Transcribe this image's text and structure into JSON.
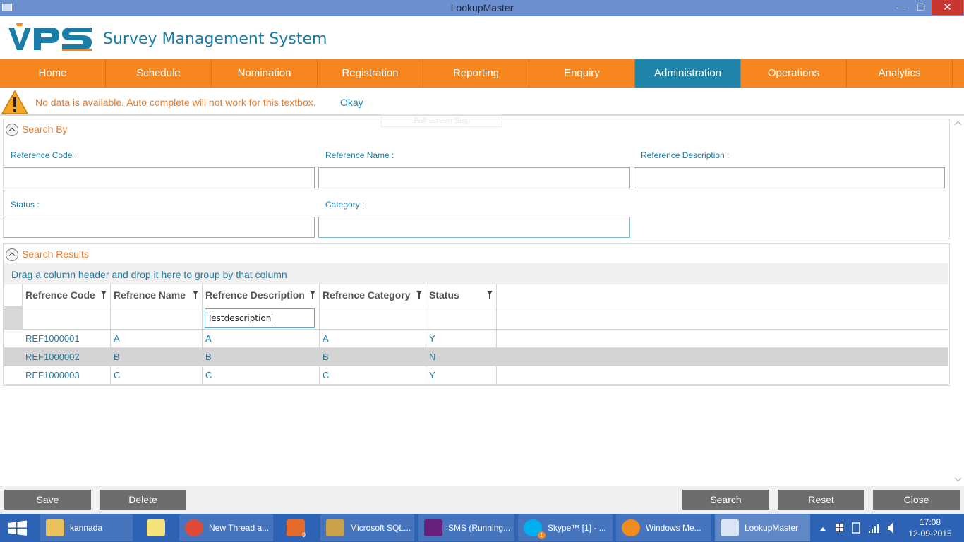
{
  "window": {
    "title": "LookupMaster",
    "minimize": "—",
    "maximize": "❐",
    "close": "✕"
  },
  "header": {
    "logo_text": "VPS",
    "brand": "Survey Management System"
  },
  "nav": {
    "items": [
      {
        "label": "Home"
      },
      {
        "label": "Schedule"
      },
      {
        "label": "Nomination"
      },
      {
        "label": "Registration"
      },
      {
        "label": "Reporting"
      },
      {
        "label": "Enquiry"
      },
      {
        "label": "Administration"
      },
      {
        "label": "Operations"
      },
      {
        "label": "Analytics"
      }
    ],
    "active": "Administration"
  },
  "warning": {
    "message": "No data is available. Auto complete will not work for this textbox.",
    "okay_label": "Okay"
  },
  "search_by": {
    "title": "Search By",
    "fields": {
      "reference_code": {
        "label": "Reference Code :",
        "value": ""
      },
      "reference_name": {
        "label": "Reference Name :",
        "value": ""
      },
      "reference_description": {
        "label": "Reference Description :",
        "value": ""
      },
      "status": {
        "label": "Status :",
        "value": ""
      },
      "category": {
        "label": "Category :",
        "value": ""
      }
    },
    "ghost_overlay": "Full-screen Snip"
  },
  "search_results": {
    "title": "Search Results",
    "group_hint": "Drag a column header and drop it here to group by that column",
    "columns": [
      "Refrence Code",
      "Refrence Name",
      "Refrence Description",
      "Refrence Category",
      "Status"
    ],
    "filter_values": {
      "description": "Testdescription"
    },
    "rows": [
      {
        "code": "REF1000001",
        "name": "A",
        "description": "A",
        "category": "A",
        "status": "Y"
      },
      {
        "code": "REF1000002",
        "name": "B",
        "description": "B",
        "category": "B",
        "status": "N"
      },
      {
        "code": "REF1000003",
        "name": "C",
        "description": "C",
        "category": "C",
        "status": "Y"
      }
    ],
    "selected_row_index": 1
  },
  "buttons": {
    "save": "Save",
    "delete": "Delete",
    "search": "Search",
    "reset": "Reset",
    "close": "Close"
  },
  "taskbar": {
    "items": [
      {
        "label": "kannada",
        "icon": "folder-icon",
        "color": "#e8c15a"
      },
      {
        "label": "",
        "icon": "sticky-notes-icon",
        "color": "#f4e27a"
      },
      {
        "label": "New Thread a...",
        "icon": "chrome-icon",
        "color": "#e04a3a"
      },
      {
        "label": "",
        "icon": "tools-icon",
        "color": "#e56b2a"
      },
      {
        "label": "Microsoft SQL...",
        "icon": "sql-server-icon",
        "color": "#c9a24a"
      },
      {
        "label": "SMS (Running...",
        "icon": "visual-studio-icon",
        "color": "#68217a"
      },
      {
        "label": "Skype™ [1] - ...",
        "icon": "skype-icon",
        "color": "#00aff0"
      },
      {
        "label": "Windows Me...",
        "icon": "windows-media-icon",
        "color": "#f08c1e"
      },
      {
        "label": "LookupMaster",
        "icon": "app-window-icon",
        "color": "#d9e4f5"
      }
    ],
    "badge_tools": "9",
    "badge_skype": "1",
    "clock_time": "17:08",
    "clock_date": "12-09-2015"
  },
  "colors": {
    "nav_orange": "#f7861e",
    "nav_active_blue": "#1f85ab",
    "link_blue": "#1a7da8",
    "warning_orange": "#e4792b",
    "titlebar_blue": "#6b8fcf",
    "taskbar_blue": "#2d62b5",
    "button_gray": "#6d6d6d"
  }
}
